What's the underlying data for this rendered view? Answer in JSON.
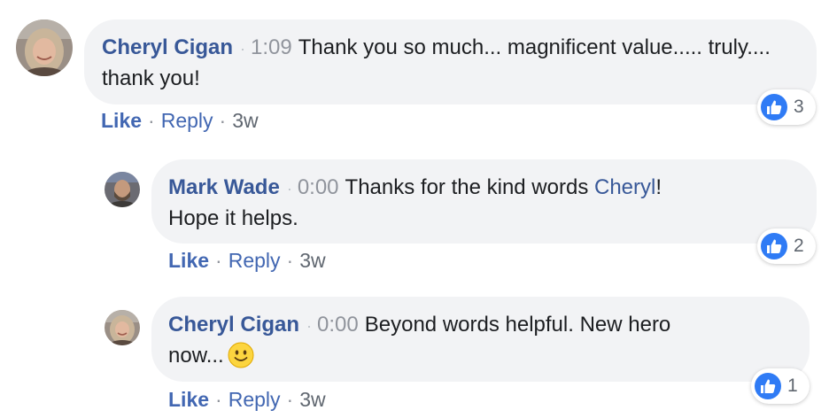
{
  "comments": [
    {
      "author": "Cheryl Cigan",
      "timestamp": "1:09",
      "text": "Thank you so much... magnificent value..... truly.... thank you!",
      "actions": {
        "like": "Like",
        "reply": "Reply",
        "age": "3w"
      },
      "reactions": {
        "icon": "thumbs-up-icon",
        "count": "3"
      }
    },
    {
      "author": "Mark Wade",
      "timestamp": "0:00",
      "text_before": "Thanks for the kind words ",
      "mention": "Cheryl",
      "text_after": "!",
      "text_line2": "Hope it helps.",
      "actions": {
        "like": "Like",
        "reply": "Reply",
        "age": "3w"
      },
      "reactions": {
        "icon": "thumbs-up-icon",
        "count": "2"
      }
    },
    {
      "author": "Cheryl Cigan",
      "timestamp": "0:00",
      "text": "Beyond words helpful. New hero",
      "text_line2": "now...",
      "emoji": "smiley-face-icon",
      "actions": {
        "like": "Like",
        "reply": "Reply",
        "age": "3w"
      },
      "reactions": {
        "icon": "thumbs-up-icon",
        "count": "1"
      }
    }
  ],
  "colors": {
    "author": "#385898",
    "action_link": "#4267b2",
    "muted": "#90949c",
    "bubble": "#f2f3f5",
    "like_blue": "#2f7bf5"
  }
}
